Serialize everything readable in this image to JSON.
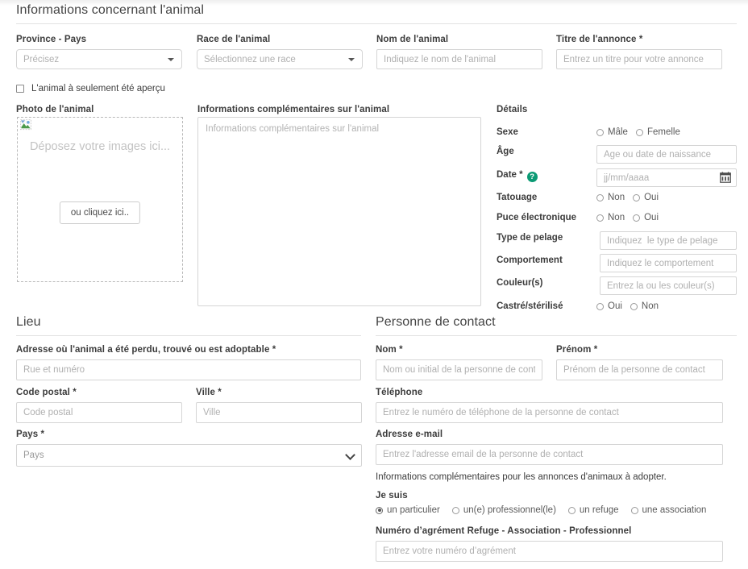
{
  "sections": {
    "animal": {
      "title": "Informations concernant l'animal"
    },
    "lieu": {
      "title": "Lieu"
    },
    "contact": {
      "title": "Personne de contact"
    }
  },
  "animal": {
    "province": {
      "label": "Province - Pays",
      "placeholder": "Précisez"
    },
    "race": {
      "label": "Race de l'animal",
      "placeholder": "Sélectionnez une race"
    },
    "nom": {
      "label": "Nom de l'animal",
      "placeholder": "Indiquez le nom de l'animal",
      "value": ""
    },
    "titre": {
      "label": "Titre de l'annonce *",
      "placeholder": "Entrez un titre pour votre annonce",
      "value": ""
    },
    "apercu_checkbox": {
      "label": "L'animal à seulement été aperçu",
      "checked": false
    },
    "photo": {
      "label": "Photo de l'animal",
      "drop_text": "Déposez votre images ici...",
      "button": "ou cliquez ici.."
    },
    "complement": {
      "label": "Informations complémentaires sur l'animal",
      "placeholder": "Informations complémentaires sur l'animal",
      "value": ""
    }
  },
  "details": {
    "title": "Détails",
    "rows": [
      {
        "label": "Sexe",
        "type": "radio",
        "options": [
          "Mâle",
          "Femelle"
        ],
        "selected": -1
      },
      {
        "label": "Âge",
        "type": "text",
        "placeholder": "Âge ou date de naissance",
        "value": ""
      },
      {
        "label": "Date *",
        "type": "date",
        "help_icon": "help-circle-icon",
        "placeholder": "jj/mm/aaaa",
        "value": ""
      },
      {
        "label": "Tatouage",
        "type": "radio",
        "options": [
          "Non",
          "Oui"
        ],
        "selected": -1
      },
      {
        "label": "Puce électronique",
        "type": "radio",
        "options": [
          "Non",
          "Oui"
        ],
        "selected": -1
      },
      {
        "label": "Type de pelage",
        "type": "text",
        "placeholder": "Indiquez  le type de pelage",
        "value": ""
      },
      {
        "label": "Comportement",
        "type": "text",
        "placeholder": "Indiquez le comportement",
        "value": ""
      },
      {
        "label": "Couleur(s)",
        "type": "text",
        "placeholder": "Entrez la ou les couleur(s)",
        "value": ""
      },
      {
        "label": "Castré/stérilisé",
        "type": "radio",
        "options": [
          "Oui",
          "Non"
        ],
        "selected": -1
      }
    ]
  },
  "lieu": {
    "adresse": {
      "label": "Adresse où l'animal a été perdu, trouvé ou est adoptable *",
      "placeholder": "Rue et numéro",
      "value": ""
    },
    "code_postal": {
      "label": "Code postal *",
      "placeholder": "Code postal",
      "value": ""
    },
    "ville": {
      "label": "Ville *",
      "placeholder": "Ville",
      "value": ""
    },
    "pays": {
      "label": "Pays *",
      "placeholder": "Pays",
      "selected": "Pays"
    }
  },
  "contact": {
    "nom": {
      "label": "Nom *",
      "placeholder": "Nom ou initial de la personne de contact",
      "value": ""
    },
    "prenom": {
      "label": "Prénom *",
      "placeholder": "Prénom de la personne de contact",
      "value": ""
    },
    "telephone": {
      "label": "Téléphone",
      "placeholder": "Entrez le numéro de téléphone de la personne de contact",
      "value": ""
    },
    "email": {
      "label": "Adresse e-mail",
      "placeholder": "Entrez l'adresse email de la personne de contact",
      "value": ""
    },
    "note": "Informations complémentaires pour les annonces d'animaux à adopter.",
    "je_suis": {
      "label": "Je suis",
      "options": [
        "un particulier",
        "un(e) professionnel(le)",
        "un refuge",
        "une association"
      ],
      "selected": 0
    },
    "agrement": {
      "label": "Numéro d’agrément Refuge - Association - Professionnel",
      "placeholder": "Entrez votre numéro d’agrément",
      "value": ""
    }
  },
  "colors": {
    "accent_green": "#0b9a74",
    "border": "#d5d5d5",
    "placeholder": "#b0b0b0",
    "text": "#3c3c3c"
  }
}
